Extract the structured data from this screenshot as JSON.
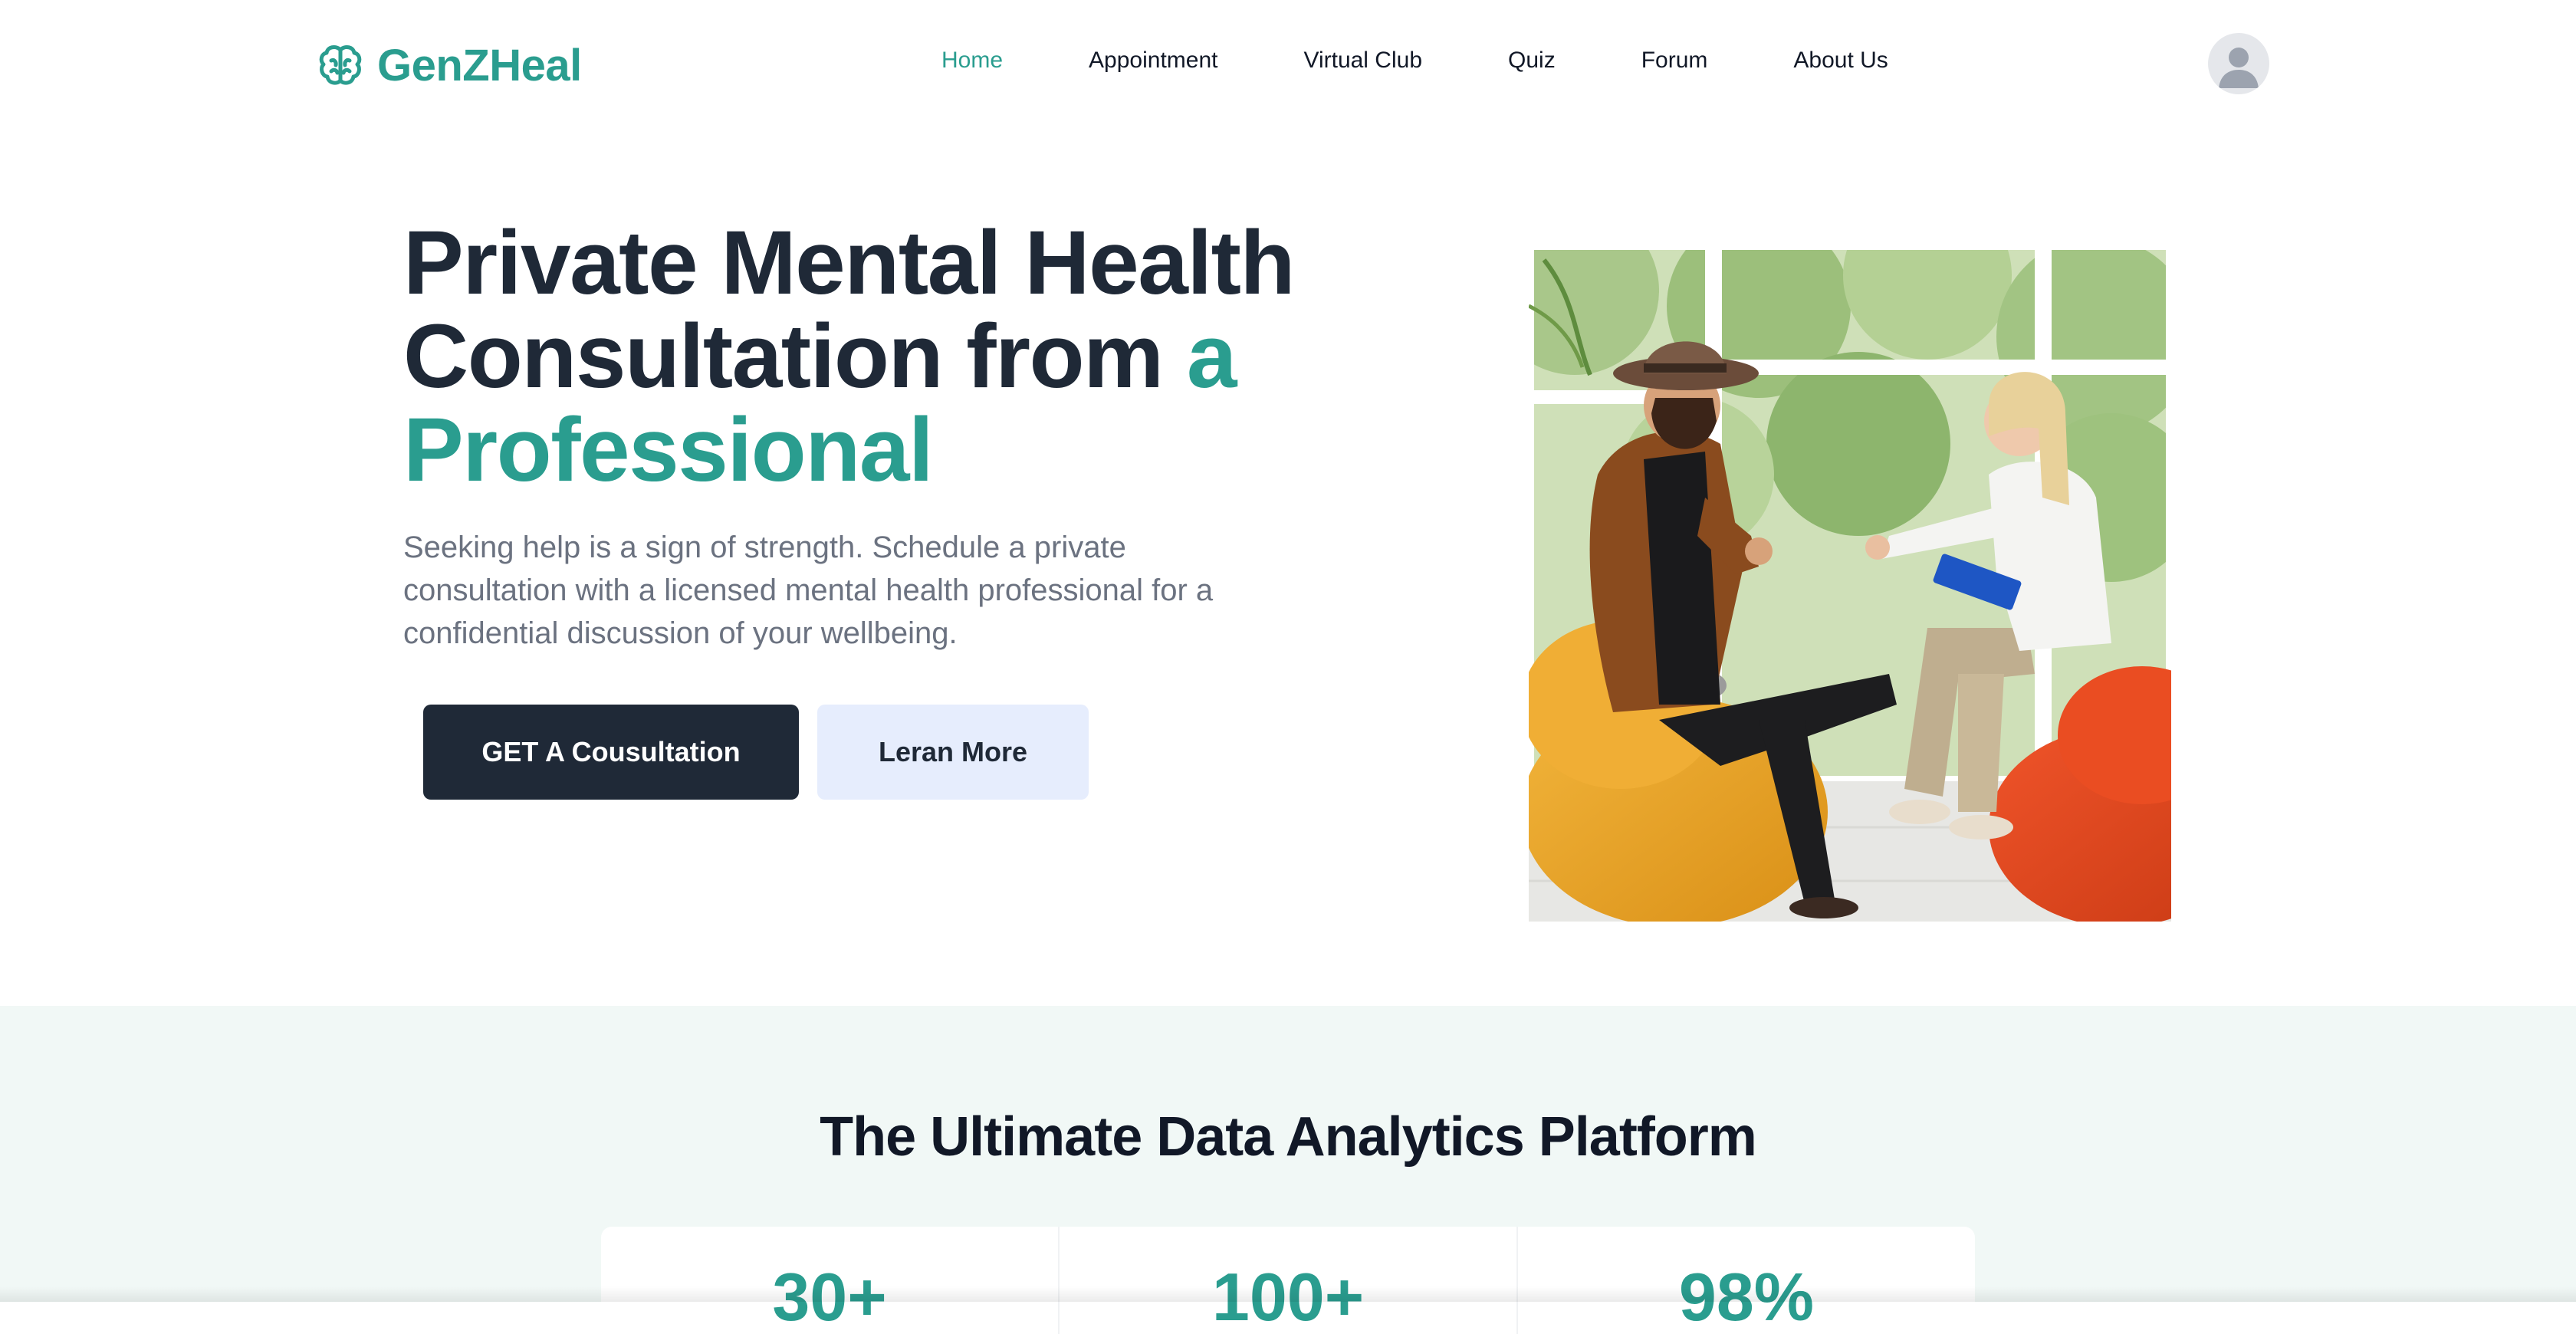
{
  "brand": {
    "name": "GenZHeal",
    "logo_icon": "brain-icon",
    "accent_color": "#2a9d8f"
  },
  "nav": {
    "items": [
      {
        "label": "Home",
        "active": true
      },
      {
        "label": "Appointment",
        "active": false
      },
      {
        "label": "Virtual Club",
        "active": false
      },
      {
        "label": "Quiz",
        "active": false
      },
      {
        "label": "Forum",
        "active": false
      },
      {
        "label": "About Us",
        "active": false
      }
    ],
    "avatar_icon": "user-avatar-icon"
  },
  "hero": {
    "title_part1": "Private Mental Health Consultation from ",
    "title_accent": "a Professional",
    "description": "Seeking help is a sign of strength. Schedule a private consultation with a licensed mental health professional for a confidential discussion of your wellbeing.",
    "primary_button": "GET A Cousultation",
    "secondary_button": "Leran More",
    "image_alt": "therapist-consultation-photo"
  },
  "stats": {
    "title": "The Ultimate Data Analytics Platform",
    "items": [
      {
        "value": "30+"
      },
      {
        "value": "100+"
      },
      {
        "value": "98%"
      }
    ]
  },
  "colors": {
    "dark": "#1f2937",
    "muted": "#6b7280",
    "section_bg": "#f1f8f6",
    "secondary_btn_bg": "#e6edfd"
  }
}
